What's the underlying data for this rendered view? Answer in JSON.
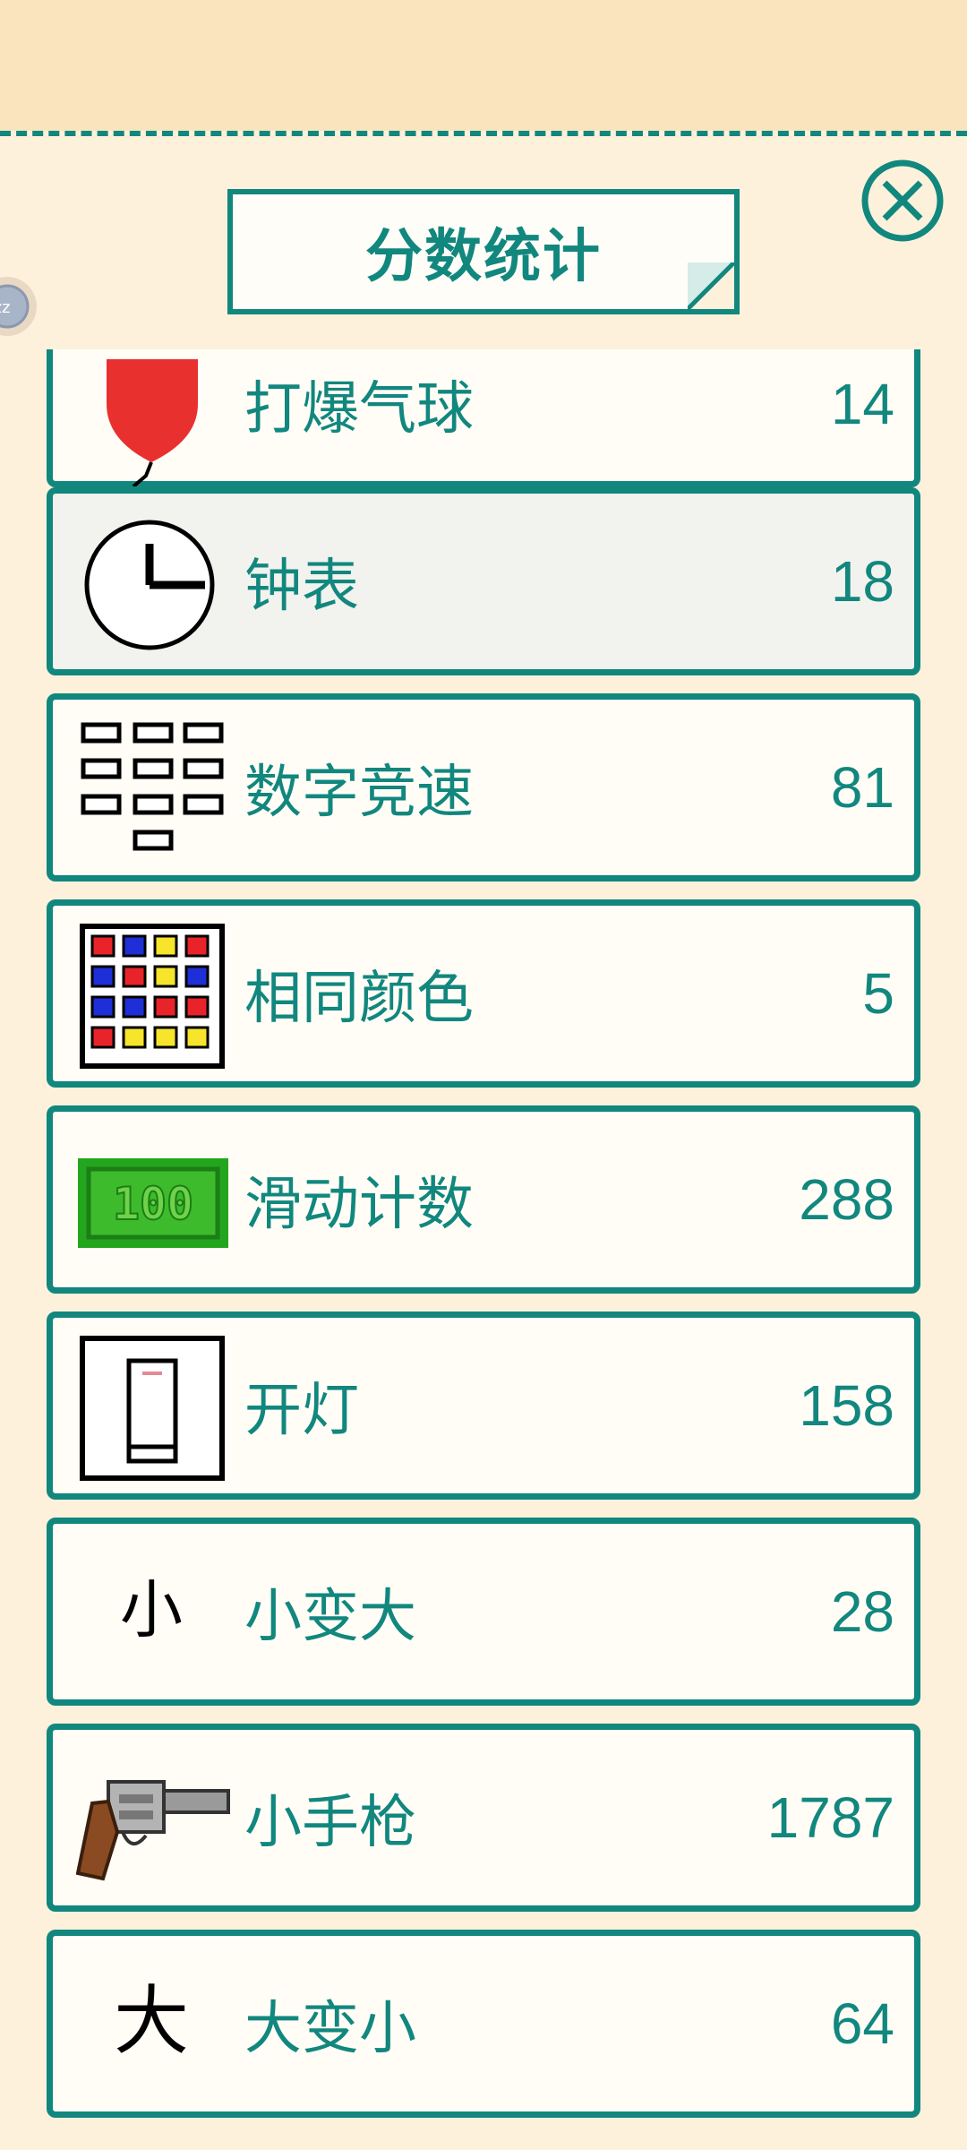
{
  "header": {
    "title": "分数统计"
  },
  "badge_text": "zz",
  "colors": {
    "accent": "#11877e",
    "panel": "#fdf1dc",
    "card": "#fffdf6"
  },
  "rows": [
    {
      "icon": "balloon-icon",
      "label": "打爆气球",
      "value": "14"
    },
    {
      "icon": "clock-icon",
      "label": "钟表",
      "value": "18"
    },
    {
      "icon": "number-grid-icon",
      "label": "数字竞速",
      "value": "81"
    },
    {
      "icon": "color-grid-icon",
      "label": "相同颜色",
      "value": "5"
    },
    {
      "icon": "banknote-icon",
      "label": "滑动计数",
      "value": "288",
      "icon_text": "100"
    },
    {
      "icon": "light-switch-icon",
      "label": "开灯",
      "value": "158"
    },
    {
      "icon": "small-char-icon",
      "label": "小变大",
      "value": "28",
      "icon_text": "小"
    },
    {
      "icon": "revolver-icon",
      "label": "小手枪",
      "value": "1787"
    },
    {
      "icon": "big-char-icon",
      "label": "大变小",
      "value": "64",
      "icon_text": "大"
    }
  ]
}
